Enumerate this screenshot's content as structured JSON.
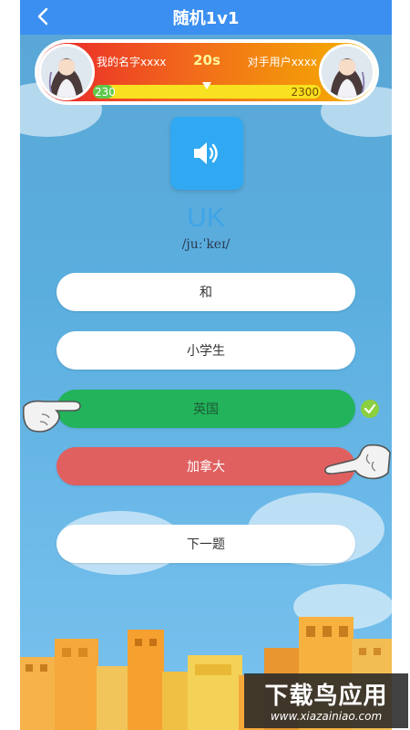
{
  "header": {
    "title": "随机1v1",
    "back_icon": "chevron-left-icon"
  },
  "battle": {
    "my_name": "我的名字xxxx",
    "opponent_name": "对手用户xxxx",
    "timer": "20s",
    "my_score": "230",
    "opponent_score": "2300",
    "my_score_share": 0.09,
    "colors": {
      "bar_start": "#e8232c",
      "bar_end": "#f4b300",
      "my_fill": "#5fc84a",
      "track": "#f7e120"
    }
  },
  "question": {
    "sound_icon": "speaker-icon",
    "word": "UK",
    "phonetic": "/juːˈkeɪ/"
  },
  "options": [
    {
      "label": "和",
      "state": "normal"
    },
    {
      "label": "小学生",
      "state": "normal"
    },
    {
      "label": "英国",
      "state": "correct"
    },
    {
      "label": "加拿大",
      "state": "wrong"
    }
  ],
  "next_button": {
    "label": "下一题"
  },
  "watermark": {
    "main": "下载鸟应用",
    "sub": "www.xiazainiao.com"
  },
  "colors": {
    "accent": "#3b8ff0",
    "correct": "#22b35b",
    "wrong": "#e06060",
    "check": "#8ccf3f"
  }
}
